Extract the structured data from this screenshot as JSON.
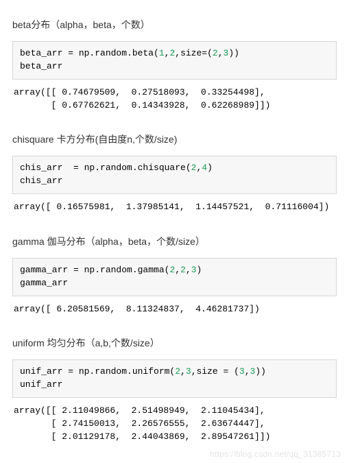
{
  "sections": [
    {
      "heading": "beta分布（alpha，beta，个数）",
      "code_html": "beta_arr = np.random.beta(<span class=\"tok-num\">1</span>,<span class=\"tok-num\">2</span>,size=(<span class=\"tok-num\">2</span>,<span class=\"tok-num\">3</span>))\nbeta_arr",
      "output": "array([[ 0.74679509,  0.27518093,  0.33254498],\n       [ 0.67762621,  0.14343928,  0.62268989]])"
    },
    {
      "heading": "chisquare 卡方分布(自由度n,个数/size)",
      "code_html": "chis_arr  = np.random.chisquare(<span class=\"tok-num\">2</span>,<span class=\"tok-num\">4</span>)\nchis_arr",
      "output": "array([ 0.16575981,  1.37985141,  1.14457521,  0.71116004])"
    },
    {
      "heading": "gamma 伽马分布（alpha，beta，个数/size）",
      "code_html": "gamma_arr = np.random.gamma(<span class=\"tok-num\">2</span>,<span class=\"tok-num\">2</span>,<span class=\"tok-num\">3</span>)\ngamma_arr",
      "output": "array([ 6.20581569,  8.11324837,  4.46281737])"
    },
    {
      "heading": "uniform 均匀分布（a,b,个数/size）",
      "code_html": "unif_arr = np.random.uniform(<span class=\"tok-num\">2</span>,<span class=\"tok-num\">3</span>,size = (<span class=\"tok-num\">3</span>,<span class=\"tok-num\">3</span>))\nunif_arr",
      "output": "array([[ 2.11049866,  2.51498949,  2.11045434],\n       [ 2.74150013,  2.26576555,  2.63674447],\n       [ 2.01129178,  2.44043869,  2.89547261]])"
    }
  ],
  "watermark": "https://blog.csdn.net/qq_31385713"
}
